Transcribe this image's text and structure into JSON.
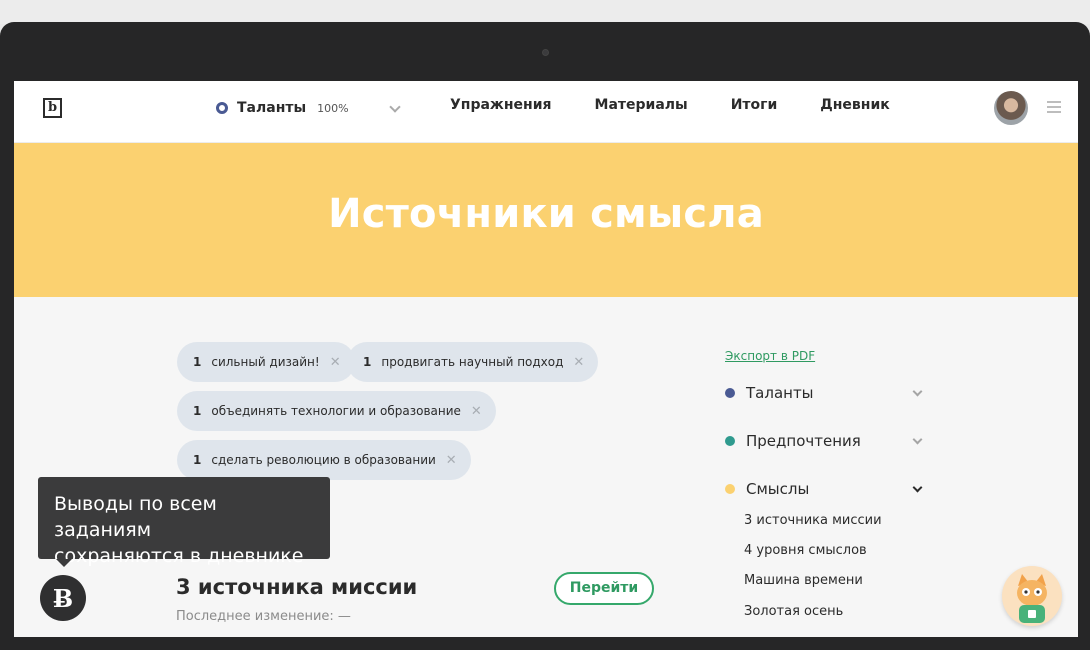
{
  "header": {
    "logo": "b",
    "module": {
      "name": "Таланты",
      "progress": "100%"
    },
    "nav": [
      "Упражнения",
      "Материалы",
      "Итоги",
      "Дневник"
    ]
  },
  "banner": {
    "title": "Источники смысла"
  },
  "chips": [
    {
      "count": "1",
      "text": "сильный дизайн!"
    },
    {
      "count": "1",
      "text": "продвигать научный подход"
    },
    {
      "count": "1",
      "text": "объединять технологии и образование"
    },
    {
      "count": "1",
      "text": "сделать революцию в образовании"
    }
  ],
  "tooltip": {
    "line1": "Выводы по всем заданиям",
    "line2": "сохраняются в дневнике"
  },
  "card": {
    "title": "3 источника миссии",
    "meta": "Последнее изменение: —",
    "button": "Перейти"
  },
  "sidebar": {
    "export": "Экспорт в PDF",
    "sections": [
      {
        "label": "Таланты",
        "color": "#4a5a93"
      },
      {
        "label": "Предпочтения",
        "color": "#2f9a8e"
      },
      {
        "label": "Смыслы",
        "color": "#fbd170"
      }
    ],
    "subitems": [
      "3 источника миссии",
      "4 уровня смыслов",
      "Машина времени",
      "Золотая осень"
    ]
  },
  "colors": {
    "accent": "#fbd170",
    "green": "#2f9a61",
    "indigo": "#4a5a93",
    "teal": "#2f9a8e"
  }
}
